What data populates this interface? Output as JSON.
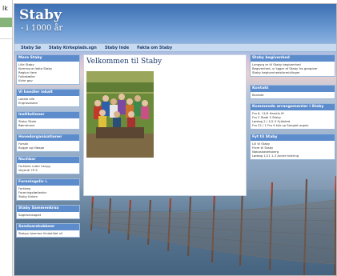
{
  "left_strip": {
    "text": "lk"
  },
  "header": {
    "title": "Staby",
    "subtitle": "- i 1000 år"
  },
  "nav": [
    {
      "label": "Staby Sø"
    },
    {
      "label": "Staby Kirkeplads.sgn"
    },
    {
      "label": "Staby Inde"
    },
    {
      "label": "Fakta om Staby"
    }
  ],
  "main": {
    "heading": "Velkommen til Staby"
  },
  "left_boxes": [
    {
      "title": "Mere Staby",
      "items": [
        "Lille Staby",
        "Kommune fakta Staby",
        "Region tiere",
        "Folketæller",
        "Kirke gav"
      ]
    },
    {
      "title": "Vi handler lokalt",
      "items": [
        "Lokale alle",
        "Engrossisten"
      ]
    },
    {
      "title": "Institutioner",
      "items": [
        "Staby Skole",
        "Børnehave"
      ]
    },
    {
      "title": "Hovedorganisationer",
      "items": [
        "Forskk",
        "Bygge og tilbage"
      ]
    },
    {
      "title": "Nachbar",
      "items": [
        "Forkkels ruder hesyg",
        "Veyerdi 79 S"
      ]
    },
    {
      "title": "Foreningsliv i.",
      "items": [
        "Forkkeg",
        "Foreningsfællesfor",
        "Staby Kirken"
      ]
    },
    {
      "title": "Staby Sammenkraa",
      "items": [
        "Sagleskraagstt"
      ]
    },
    {
      "title": "Sandaarskobbeer",
      "items": [
        "Stabys hjemme Vindstillet vil"
      ]
    }
  ],
  "right_boxes": [
    {
      "title": "Staby begivenhed",
      "items": [
        "Langsrg er til Staby begivenhed",
        "Begivenhed, vi ligger af Staby fra gengiver",
        "Staby begivenhedsformidlinger"
      ]
    },
    {
      "title": "Kontakt",
      "items": [
        "Kontakt"
      ]
    },
    {
      "title": "Kommende arrangementer i Staby",
      "items": [
        "Fra 6, 11/9 Handlu M",
        "Fra 2 Stabi 5 Staby",
        "Lørdag 2 / 1/2-3 Fyldsted",
        "Fra 22 / 1 Fra 9 kilo sp Sanglet orgels"
      ]
    },
    {
      "title": "Fyt til Staby",
      "items": [
        "Lill til Staby",
        "Flere til Staby",
        "Naboskabetsberg",
        "Lørdag 1/11 1-3 Andre folkring"
      ]
    }
  ]
}
